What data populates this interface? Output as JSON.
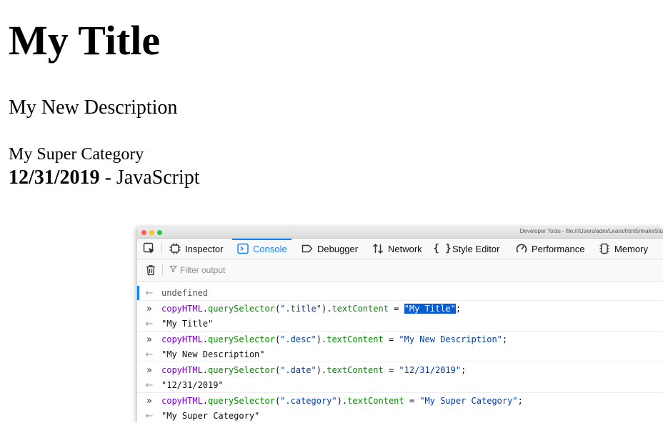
{
  "page": {
    "title": "My Title",
    "description": "My New Description",
    "category": "My Super Category",
    "date": "12/31/2019",
    "date_separator": " - ",
    "topic": "JavaScript"
  },
  "devtools": {
    "window_title": "Developer Tools - file:///Users/adm/Learn/html5/makeStu",
    "tabs": [
      {
        "label": "Inspector",
        "icon": "inspector-icon"
      },
      {
        "label": "Console",
        "icon": "console-icon",
        "selected": true
      },
      {
        "label": "Debugger",
        "icon": "debugger-icon"
      },
      {
        "label": "Network",
        "icon": "network-icon"
      },
      {
        "label": "Style Editor",
        "icon": "style-editor-icon"
      },
      {
        "label": "Performance",
        "icon": "performance-icon"
      },
      {
        "label": "Memory",
        "icon": "memory-icon"
      }
    ],
    "filter_placeholder": "Filter output",
    "accent_color": "#0a84ff",
    "console": {
      "first_result": "undefined",
      "commands": [
        {
          "object": "copyHTML",
          "dot1": ".",
          "method": "querySelector",
          "open": "(",
          "selector": "\".title\"",
          "close": ")",
          "dot2": ".",
          "prop": "textContent",
          "eq": " = ",
          "value": "\"My Title\"",
          "end": ";",
          "result": "\"My Title\""
        },
        {
          "object": "copyHTML",
          "dot1": ".",
          "method": "querySelector",
          "open": "(",
          "selector": "\".desc\"",
          "close": ")",
          "dot2": ".",
          "prop": "textContent",
          "eq": " = ",
          "value": "\"My New Description\"",
          "end": ";",
          "result": "\"My New Description\""
        },
        {
          "object": "copyHTML",
          "dot1": ".",
          "method": "querySelector",
          "open": "(",
          "selector": "\".date\"",
          "close": ")",
          "dot2": ".",
          "prop": "textContent",
          "eq": " = ",
          "value": "\"12/31/2019\"",
          "end": ";",
          "result": "\"12/31/2019\""
        },
        {
          "object": "copyHTML",
          "dot1": ".",
          "method": "querySelector",
          "open": "(",
          "selector": "\".category\"",
          "close": ")",
          "dot2": ".",
          "prop": "textContent",
          "eq": " = ",
          "value": "\"My Super Category\"",
          "end": ";",
          "result": "\"My Super Category\""
        }
      ]
    }
  }
}
